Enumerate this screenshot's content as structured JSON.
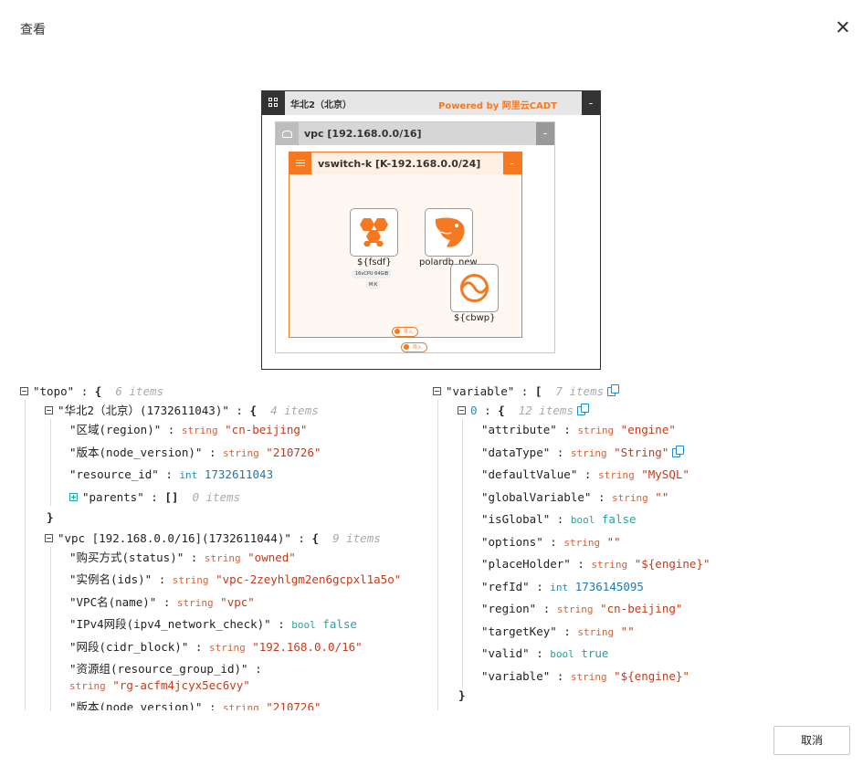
{
  "dialog": {
    "title": "查看",
    "cancel_label": "取消"
  },
  "topology": {
    "region_title": "华北2（北京）",
    "powered_by": "Powered by 阿里云CADT",
    "collapse": "-",
    "vpc_title": "vpc [192.168.0.0/16]",
    "vswitch_title": "vswitch-k [K-192.168.0.0/24]",
    "nodes": {
      "ecs_label": "${fsdf}",
      "ecs_spec": "16vCPU 64GiB",
      "ecs_tag": "M:K",
      "polardb_label": "polardb_new",
      "cbwp_label": "${cbwp}"
    },
    "pill_inner": "导入",
    "pill_outer": "导入"
  },
  "left_tree": {
    "topo_key": "\"topo\"",
    "topo_meta": "6 items",
    "region_key": "\"华北2（北京）(1732611043)\"",
    "region_meta": "4 items",
    "region_fields": [
      {
        "key": "\"区域(region)\"",
        "type": "string",
        "value": "\"cn-beijing\""
      },
      {
        "key": "\"版本(node_version)\"",
        "type": "string",
        "value": "\"210726\""
      },
      {
        "key": "\"resource_id\"",
        "type": "int",
        "value": "1732611043"
      }
    ],
    "parents_key": "\"parents\"",
    "parents_meta": "0 items",
    "vpc_key": "\"vpc [192.168.0.0/16](1732611044)\"",
    "vpc_meta": "9 items",
    "vpc_fields": [
      {
        "key": "\"购买方式(status)\"",
        "type": "string",
        "value": "\"owned\""
      },
      {
        "key": "\"实例名(ids)\"",
        "type": "string",
        "value": "\"vpc-2zeyhlgm2en6gcpxl1a5o\""
      },
      {
        "key": "\"VPC名(name)\"",
        "type": "string",
        "value": "\"vpc\""
      },
      {
        "key": "\"IPv4网段(ipv4_network_check)\"",
        "type": "bool",
        "value": "false"
      },
      {
        "key": "\"网段(cidr_block)\"",
        "type": "string",
        "value": "\"192.168.0.0/16\""
      },
      {
        "key": "\"资源组(resource_group_id)\"",
        "type": "string",
        "value": "\"rg-acfm4jcyx5ec6vy\""
      },
      {
        "key": "\"版本(node_version)\"",
        "type": "string",
        "value": "\"210726\""
      }
    ]
  },
  "right_tree": {
    "variable_key": "\"variable\"",
    "variable_meta": "7 items",
    "item_key": "0",
    "item_meta": "12 items",
    "fields": [
      {
        "key": "\"attribute\"",
        "type": "string",
        "value": "\"engine\""
      },
      {
        "key": "\"dataType\"",
        "type": "string",
        "value": "\"String\""
      },
      {
        "key": "\"defaultValue\"",
        "type": "string",
        "value": "\"MySQL\""
      },
      {
        "key": "\"globalVariable\"",
        "type": "string",
        "value": "\"\""
      },
      {
        "key": "\"isGlobal\"",
        "type": "bool",
        "value": "false"
      },
      {
        "key": "\"options\"",
        "type": "string",
        "value": "\"\""
      },
      {
        "key": "\"placeHolder\"",
        "type": "string",
        "value": "\"${engine}\""
      },
      {
        "key": "\"refId\"",
        "type": "int",
        "value": "1736145095"
      },
      {
        "key": "\"region\"",
        "type": "string",
        "value": "\"cn-beijing\""
      },
      {
        "key": "\"targetKey\"",
        "type": "string",
        "value": "\"\""
      },
      {
        "key": "\"valid\"",
        "type": "bool",
        "value": "true"
      },
      {
        "key": "\"variable\"",
        "type": "string",
        "value": "\"${engine}\""
      }
    ]
  },
  "syntax": {
    "colon": ":",
    "open_obj": "{",
    "close_obj": "}",
    "open_arr": "[",
    "empty_arr": "[]"
  }
}
